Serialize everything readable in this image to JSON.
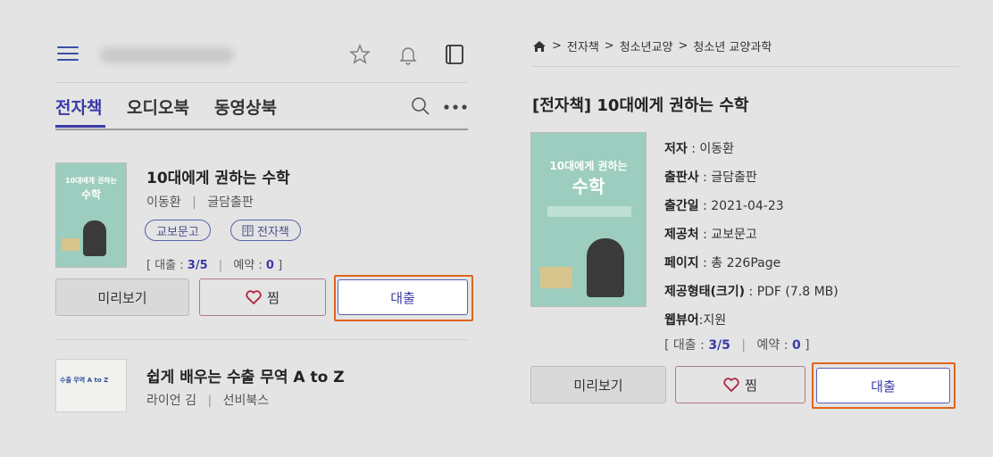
{
  "left": {
    "tabs": [
      "전자책",
      "오디오북",
      "동영상북"
    ],
    "items": [
      {
        "title": "10대에게 권하는 수학",
        "author": "이동환",
        "publisher": "글담출판",
        "badges": [
          "교보문고",
          "전자책"
        ],
        "loan_label": "대출 : ",
        "loan_value": "3/5",
        "reserve_label": "예약 : ",
        "reserve_value": "0",
        "thumb_text_line1": "10대에게 권하는",
        "thumb_text_line2": "수학"
      },
      {
        "title": "쉽게 배우는 수출 무역 A to Z",
        "author": "라이언 김",
        "publisher": "선비북스",
        "thumb_text": "수출 무역 A to Z"
      }
    ],
    "buttons": {
      "preview": "미리보기",
      "wish": "찜",
      "loan": "대출"
    },
    "separator": "|"
  },
  "right": {
    "breadcrumb": [
      "전자책",
      "청소년교양",
      "청소년 교양과학"
    ],
    "title": "[전자책] 10대에게 권하는 수학",
    "thumb_text_line1": "10대에게 권하는",
    "thumb_text_line2": "수학",
    "info": [
      {
        "label": "저자",
        "value": "이동환"
      },
      {
        "label": "출판사",
        "value": "글담출판"
      },
      {
        "label": "출간일",
        "value": "2021-04-23"
      },
      {
        "label": "제공처",
        "value": "교보문고"
      },
      {
        "label": "페이지",
        "value": "총 226Page"
      },
      {
        "label": "제공형태(크기)",
        "value": "PDF (7.8 MB)"
      },
      {
        "label": "웹뷰어",
        "value": "지원"
      }
    ],
    "loan_label": "대출 : ",
    "loan_value": "3/5",
    "reserve_label": "예약 : ",
    "reserve_value": "0",
    "buttons": {
      "preview": "미리보기",
      "wish": "찜",
      "loan": "대출"
    }
  },
  "colors": {
    "accent": "#3b3aa6",
    "highlight": "#e0641e",
    "thumb": "#9ccdbf"
  },
  "icons": [
    "hamburger-icon",
    "star-icon",
    "bell-icon",
    "book-icon",
    "search-icon",
    "more-icon",
    "home-icon",
    "heart-icon",
    "ebook-icon"
  ]
}
